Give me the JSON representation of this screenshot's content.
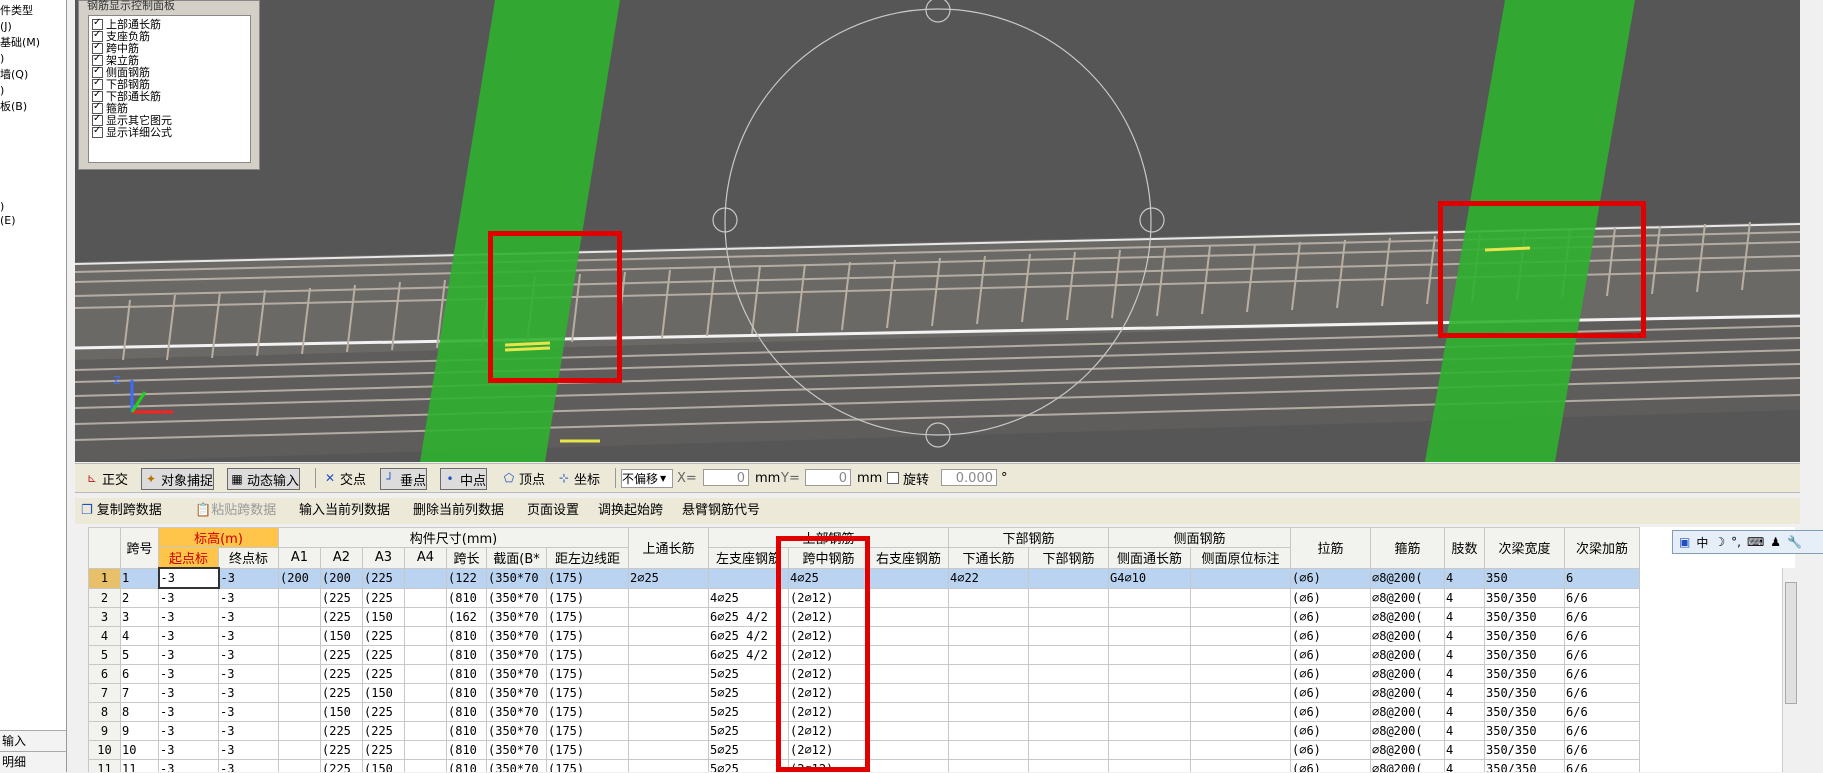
{
  "left_tree": {
    "items": [
      "件类型",
      "(J)",
      "基础(M)",
      ")",
      "墙(Q)",
      ")",
      "板(B)",
      ")",
      "(E)"
    ],
    "bottom": [
      "输入",
      "明细"
    ]
  },
  "legend": {
    "title": "钢筋显示控制面板",
    "items": [
      "上部通长筋",
      "支座负筋",
      "跨中筋",
      "架立筋",
      "侧面钢筋",
      "下部钢筋",
      "下部通长筋",
      "箍筋",
      "显示其它图元",
      "显示详细公式"
    ]
  },
  "snapbar": {
    "ortho": "正交",
    "object_snap": "对象捕捉",
    "dynamic_input": "动态输入",
    "intersection": "交点",
    "perpendicular": "垂点",
    "midpoint": "中点",
    "vertex": "顶点",
    "coordinate": "坐标",
    "offset_select": "不偏移",
    "x_label": "X=",
    "x_value": "0",
    "x_unit": "mm",
    "y_label": "Y=",
    "y_value": "0",
    "y_unit": "mm",
    "rotate_label": "旋转",
    "rotate_value": "0.000",
    "degree": "°"
  },
  "table_toolbar": {
    "copy_span": "复制跨数据",
    "paste_span": "粘贴跨数据",
    "input_column": "输入当前列数据",
    "delete_column": "删除当前列数据",
    "page_setup": "页面设置",
    "swap_start": "调换起始跨",
    "cantilever_code": "悬臂钢筋代号"
  },
  "ime": {
    "items": [
      "中",
      "☽",
      "°,",
      "⌨",
      "♟",
      "🔧"
    ]
  },
  "grid": {
    "header_groups": {
      "span_no": "跨号",
      "elevation": "标高(m)",
      "dimensions": "构件尺寸(mm)",
      "top_through": "上通长筋",
      "top_rebar": "上部钢筋",
      "bottom_rebar": "下部钢筋",
      "side_rebar": "侧面钢筋",
      "stirrup": "箍筋",
      "legs": "肢数",
      "sub_beam_width": "次梁宽度",
      "sub_beam_add": "次梁加筋"
    },
    "sub_headers": {
      "start_elev": "起点标",
      "end_elev": "终点标",
      "a1": "A1",
      "a2": "A2",
      "a3": "A3",
      "a4": "A4",
      "span_len": "跨长",
      "section": "截面(B*",
      "dist_edge": "距左边线距",
      "left_support": "左支座钢筋",
      "mid_span": "跨中钢筋",
      "right_support": "右支座钢筋",
      "bottom_through": "下通长筋",
      "bottom_bars": "下部钢筋",
      "side_through": "侧面通长筋",
      "side_original": "侧面原位标注",
      "tie_bar": "拉筋"
    },
    "rows": [
      [
        "1",
        "1",
        "-3",
        "-3",
        "(200",
        "(200",
        "(225",
        "",
        "(122",
        "(350*70",
        "(175)",
        "2⌀25",
        "",
        "4⌀25",
        "",
        "4⌀22",
        "",
        "G4⌀10",
        "",
        "(⌀6)",
        "⌀8@200(",
        "4",
        "350",
        "6"
      ],
      [
        "2",
        "2",
        "-3",
        "-3",
        "",
        "(225",
        "(225",
        "",
        "(810",
        "(350*70",
        "(175)",
        "",
        "4⌀25",
        "(2⌀12)",
        "",
        "",
        "",
        "",
        "",
        "(⌀6)",
        "⌀8@200(",
        "4",
        "350/350",
        "6/6"
      ],
      [
        "3",
        "3",
        "-3",
        "-3",
        "",
        "(225",
        "(150",
        "",
        "(162",
        "(350*70",
        "(175)",
        "",
        "6⌀25 4/2",
        "(2⌀12)",
        "",
        "",
        "",
        "",
        "",
        "(⌀6)",
        "⌀8@200(",
        "4",
        "350/350",
        "6/6"
      ],
      [
        "4",
        "4",
        "-3",
        "-3",
        "",
        "(150",
        "(225",
        "",
        "(810",
        "(350*70",
        "(175)",
        "",
        "6⌀25 4/2",
        "(2⌀12)",
        "",
        "",
        "",
        "",
        "",
        "(⌀6)",
        "⌀8@200(",
        "4",
        "350/350",
        "6/6"
      ],
      [
        "5",
        "5",
        "-3",
        "-3",
        "",
        "(225",
        "(225",
        "",
        "(810",
        "(350*70",
        "(175)",
        "",
        "6⌀25 4/2",
        "(2⌀12)",
        "",
        "",
        "",
        "",
        "",
        "(⌀6)",
        "⌀8@200(",
        "4",
        "350/350",
        "6/6"
      ],
      [
        "6",
        "6",
        "-3",
        "-3",
        "",
        "(225",
        "(225",
        "",
        "(810",
        "(350*70",
        "(175)",
        "",
        "5⌀25",
        "(2⌀12)",
        "",
        "",
        "",
        "",
        "",
        "(⌀6)",
        "⌀8@200(",
        "4",
        "350/350",
        "6/6"
      ],
      [
        "7",
        "7",
        "-3",
        "-3",
        "",
        "(225",
        "(150",
        "",
        "(810",
        "(350*70",
        "(175)",
        "",
        "5⌀25",
        "(2⌀12)",
        "",
        "",
        "",
        "",
        "",
        "(⌀6)",
        "⌀8@200(",
        "4",
        "350/350",
        "6/6"
      ],
      [
        "8",
        "8",
        "-3",
        "-3",
        "",
        "(150",
        "(225",
        "",
        "(810",
        "(350*70",
        "(175)",
        "",
        "5⌀25",
        "(2⌀12)",
        "",
        "",
        "",
        "",
        "",
        "(⌀6)",
        "⌀8@200(",
        "4",
        "350/350",
        "6/6"
      ],
      [
        "9",
        "9",
        "-3",
        "-3",
        "",
        "(225",
        "(225",
        "",
        "(810",
        "(350*70",
        "(175)",
        "",
        "5⌀25",
        "(2⌀12)",
        "",
        "",
        "",
        "",
        "",
        "(⌀6)",
        "⌀8@200(",
        "4",
        "350/350",
        "6/6"
      ],
      [
        "10",
        "10",
        "-3",
        "-3",
        "",
        "(225",
        "(225",
        "",
        "(810",
        "(350*70",
        "(175)",
        "",
        "5⌀25",
        "(2⌀12)",
        "",
        "",
        "",
        "",
        "",
        "(⌀6)",
        "⌀8@200(",
        "4",
        "350/350",
        "6/6"
      ],
      [
        "11",
        "11",
        "-3",
        "-3",
        "",
        "(225",
        "(150",
        "",
        "(810",
        "(350*70",
        "(175)",
        "",
        "5⌀25",
        "(2⌀12)",
        "",
        "",
        "",
        "",
        "",
        "(⌀6)",
        "⌀8@200(",
        "4",
        "350/350",
        "6/6"
      ]
    ]
  },
  "colors": {
    "viewport_bg": "#555555",
    "band_green": "#2fb02f",
    "highlight_red": "#e00000",
    "selected_row": "#b9d3f0",
    "elevation_header": "#ffc54a"
  }
}
